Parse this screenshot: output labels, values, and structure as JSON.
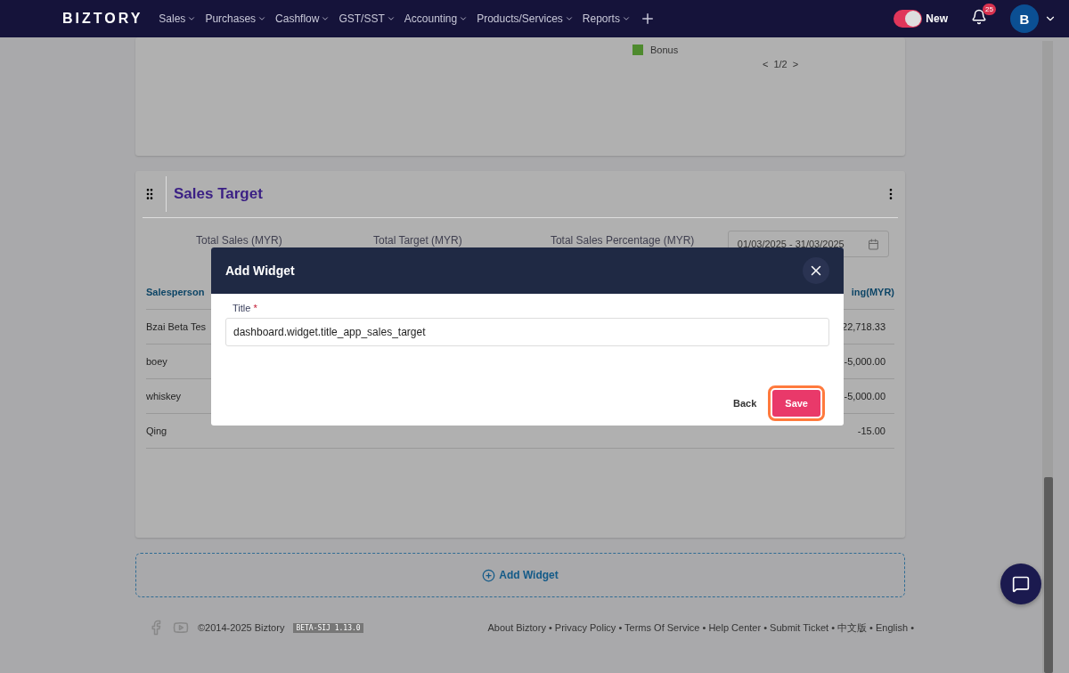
{
  "header": {
    "brand": "BIZTORY",
    "nav": [
      {
        "label": "Sales"
      },
      {
        "label": "Purchases"
      },
      {
        "label": "Cashflow"
      },
      {
        "label": "GST/SST"
      },
      {
        "label": "Accounting"
      },
      {
        "label": "Products/Services"
      },
      {
        "label": "Reports"
      }
    ],
    "toggle": {
      "label": "New",
      "on": true
    },
    "notifications": {
      "count": "25"
    },
    "avatar": {
      "initial": "B"
    }
  },
  "chart_card": {
    "legend": [
      {
        "label": "Bonus",
        "color": "#4e8a2e"
      }
    ],
    "pager": {
      "prev": "<",
      "page": "1/2",
      "next": ">"
    }
  },
  "sales_target": {
    "title": "Sales Target",
    "summary": [
      "Total Sales (MYR)",
      "Total Target (MYR)",
      "Total Sales Percentage (MYR)"
    ],
    "date_range": "01/03/2025 - 31/03/2025",
    "columns": [
      "Salesperson",
      "ing(MYR)"
    ],
    "rows": [
      {
        "name": "Bzai Beta Tes",
        "last": "22,718.33"
      },
      {
        "name": "boey",
        "last": "-5,000.00"
      },
      {
        "name": "whiskey",
        "last": "-5,000.00"
      },
      {
        "name": "Qing",
        "last": "-15.00"
      }
    ]
  },
  "add_widget": "Add Widget",
  "footer": {
    "copyright": "©2014-2025 Biztory",
    "version": "BETA-SIJ 1.13.0",
    "links": "About Biztory • Privacy Policy • Terms Of Service • Help Center • Submit Ticket • 中文版 • English •"
  },
  "dialog": {
    "title": "Add Widget",
    "field": {
      "label": "Title",
      "required_mark": "*",
      "value": "dashboard.widget.title_app_sales_target"
    },
    "buttons": [
      {
        "label": "Back",
        "kind": "text",
        "highlighted": false
      },
      {
        "label": "Save",
        "kind": "primary",
        "highlighted": true
      }
    ]
  }
}
